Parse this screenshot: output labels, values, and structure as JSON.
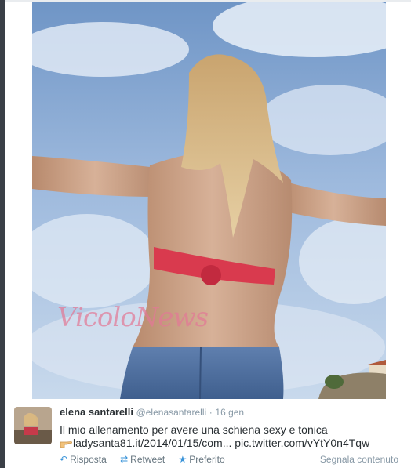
{
  "photo": {
    "description_icon": "photo-image",
    "watermark": "VicoloNews"
  },
  "tweet": {
    "author_name": "elena santarelli",
    "author_handle": "@elenasantarelli",
    "separator": "·",
    "time": "16 gen",
    "text_line1": "Il mio allenamento per avere una schiena sexy e tonica",
    "text_line2": "ladysanta81.it/2014/01/15/com... pic.twitter.com/vYtY0n4Tqw",
    "actions": {
      "reply": "Risposta",
      "retweet": "Retweet",
      "favorite": "Preferito"
    },
    "report_label": "Segnala contenuto"
  },
  "colors": {
    "link": "#3b94d9",
    "muted": "#8899a6",
    "text": "#292f33"
  }
}
